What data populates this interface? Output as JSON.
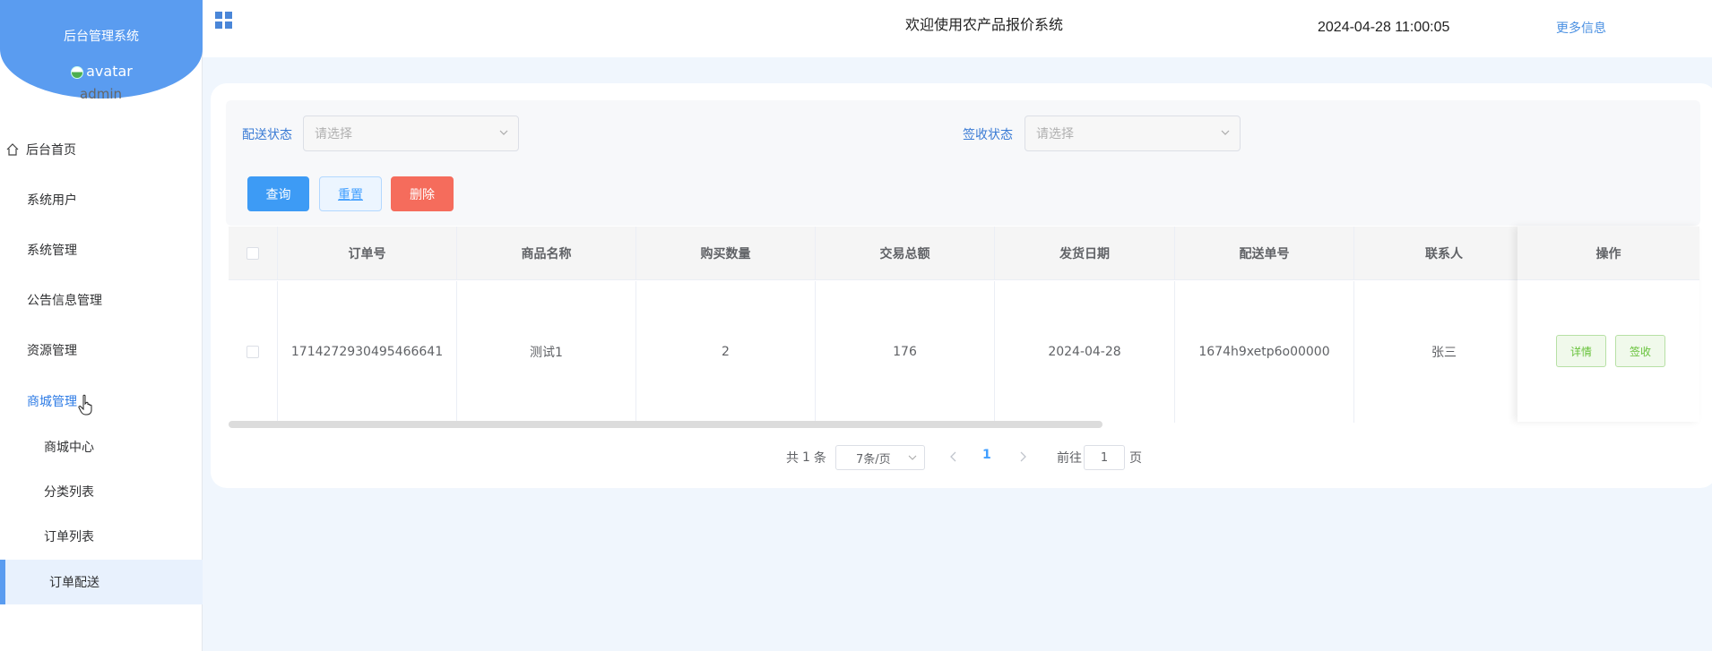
{
  "sidebar": {
    "brand_title": "后台管理系统",
    "avatar_alt": "avatar",
    "username": "admin",
    "items": [
      {
        "label": "后台首页"
      },
      {
        "label": "系统用户"
      },
      {
        "label": "系统管理"
      },
      {
        "label": "公告信息管理"
      },
      {
        "label": "资源管理"
      },
      {
        "label": "商城管理"
      },
      {
        "label": "商城中心"
      },
      {
        "label": "分类列表"
      },
      {
        "label": "订单列表"
      },
      {
        "label": "订单配送"
      }
    ]
  },
  "header": {
    "title": "欢迎使用农产品报价系统",
    "time": "2024-04-28 11:00:05",
    "more": "更多信息"
  },
  "filters": {
    "delivery_label": "配送状态",
    "delivery_placeholder": "请选择",
    "sign_label": "签收状态",
    "sign_placeholder": "请选择"
  },
  "buttons": {
    "query": "查询",
    "reset": "重置",
    "delete": "删除"
  },
  "table": {
    "columns": [
      "订单号",
      "商品名称",
      "购买数量",
      "交易总额",
      "发货日期",
      "配送单号",
      "联系人",
      "操作"
    ],
    "rows": [
      {
        "order_no": "1714272930495466641",
        "product": "测试1",
        "qty": "2",
        "total": "176",
        "ship_date": "2024-04-28",
        "delivery_no": "1674h9xetp6o00000",
        "contact": "张三",
        "detail_btn": "详情",
        "sign_btn": "签收"
      }
    ]
  },
  "pagination": {
    "total_prefix": "共",
    "total": "1",
    "total_suffix": "条",
    "page_size": "7条/页",
    "current_page": "1",
    "goto_prefix": "前往",
    "goto_value": "1",
    "goto_suffix": "页"
  },
  "colors": {
    "brand": "#5a9cf0",
    "primary": "#3d9bf5",
    "danger": "#f56c5c",
    "success": "#67c23a"
  }
}
